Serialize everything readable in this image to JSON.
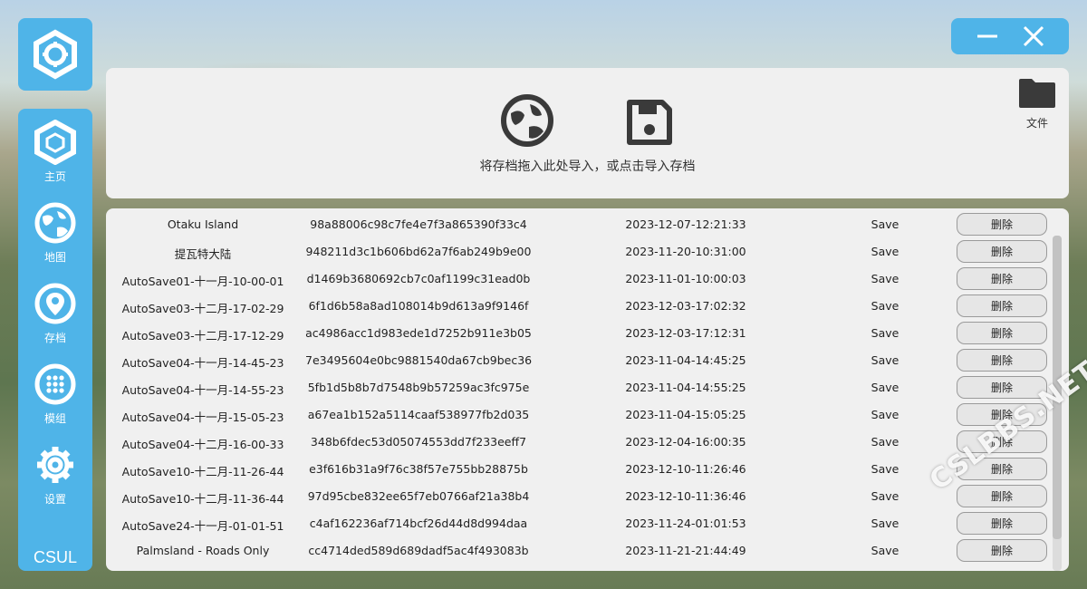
{
  "sidebar": {
    "items": [
      {
        "label": "主页",
        "icon": "cube-home-icon"
      },
      {
        "label": "地图",
        "icon": "globe-icon"
      },
      {
        "label": "存档",
        "icon": "location-pin-icon"
      },
      {
        "label": "模组",
        "icon": "dots-grid-icon"
      },
      {
        "label": "设置",
        "icon": "gear-icon"
      }
    ],
    "brand": "CSUL"
  },
  "import_panel": {
    "hint": "将存档拖入此处导入，或点击导入存档",
    "file_label": "文件"
  },
  "saves": {
    "rows": [
      {
        "name": "Otaku Island",
        "hash": "98a88006c98c7fe4e7f3a865390f33c4",
        "date": "2023-12-07-12:21:33",
        "type": "Save",
        "action": "删除"
      },
      {
        "name": "提瓦特大陆",
        "hash": "948211d3c1b606bd62a7f6ab249b9e00",
        "date": "2023-11-20-10:31:00",
        "type": "Save",
        "action": "删除"
      },
      {
        "name": "AutoSave01-十一月-10-00-01",
        "hash": "d1469b3680692cb7c0af1199c31ead0b",
        "date": "2023-11-01-10:00:03",
        "type": "Save",
        "action": "删除"
      },
      {
        "name": "AutoSave03-十二月-17-02-29",
        "hash": "6f1d6b58a8ad108014b9d613a9f9146f",
        "date": "2023-12-03-17:02:32",
        "type": "Save",
        "action": "删除"
      },
      {
        "name": "AutoSave03-十二月-17-12-29",
        "hash": "ac4986acc1d983ede1d7252b911e3b05",
        "date": "2023-12-03-17:12:31",
        "type": "Save",
        "action": "删除"
      },
      {
        "name": "AutoSave04-十一月-14-45-23",
        "hash": "7e3495604e0bc9881540da67cb9bec36",
        "date": "2023-11-04-14:45:25",
        "type": "Save",
        "action": "删除"
      },
      {
        "name": "AutoSave04-十一月-14-55-23",
        "hash": "5fb1d5b8b7d7548b9b57259ac3fc975e",
        "date": "2023-11-04-14:55:25",
        "type": "Save",
        "action": "删除"
      },
      {
        "name": "AutoSave04-十一月-15-05-23",
        "hash": "a67ea1b152a5114caaf538977fb2d035",
        "date": "2023-11-04-15:05:25",
        "type": "Save",
        "action": "删除"
      },
      {
        "name": "AutoSave04-十二月-16-00-33",
        "hash": "348b6fdec53d05074553dd7f233eeff7",
        "date": "2023-12-04-16:00:35",
        "type": "Save",
        "action": "删除"
      },
      {
        "name": "AutoSave10-十二月-11-26-44",
        "hash": "e3f616b31a9f76c38f57e755bb28875b",
        "date": "2023-12-10-11:26:46",
        "type": "Save",
        "action": "删除"
      },
      {
        "name": "AutoSave10-十二月-11-36-44",
        "hash": "97d95cbe832ee65f7eb0766af21a38b4",
        "date": "2023-12-10-11:36:46",
        "type": "Save",
        "action": "删除"
      },
      {
        "name": "AutoSave24-十一月-01-01-51",
        "hash": "c4af162236af714bcf26d44d8d994daa",
        "date": "2023-11-24-01:01:53",
        "type": "Save",
        "action": "删除"
      },
      {
        "name": "Palmsland - Roads Only",
        "hash": "cc4714ded589d689dadf5ac4f493083b",
        "date": "2023-11-21-21:44:49",
        "type": "Save",
        "action": "删除"
      }
    ]
  },
  "watermark": "CSLBBS.NET",
  "colors": {
    "accent": "#4fb4e8",
    "panel": "#f0f0f0",
    "icon_dark": "#3a3a3a"
  }
}
